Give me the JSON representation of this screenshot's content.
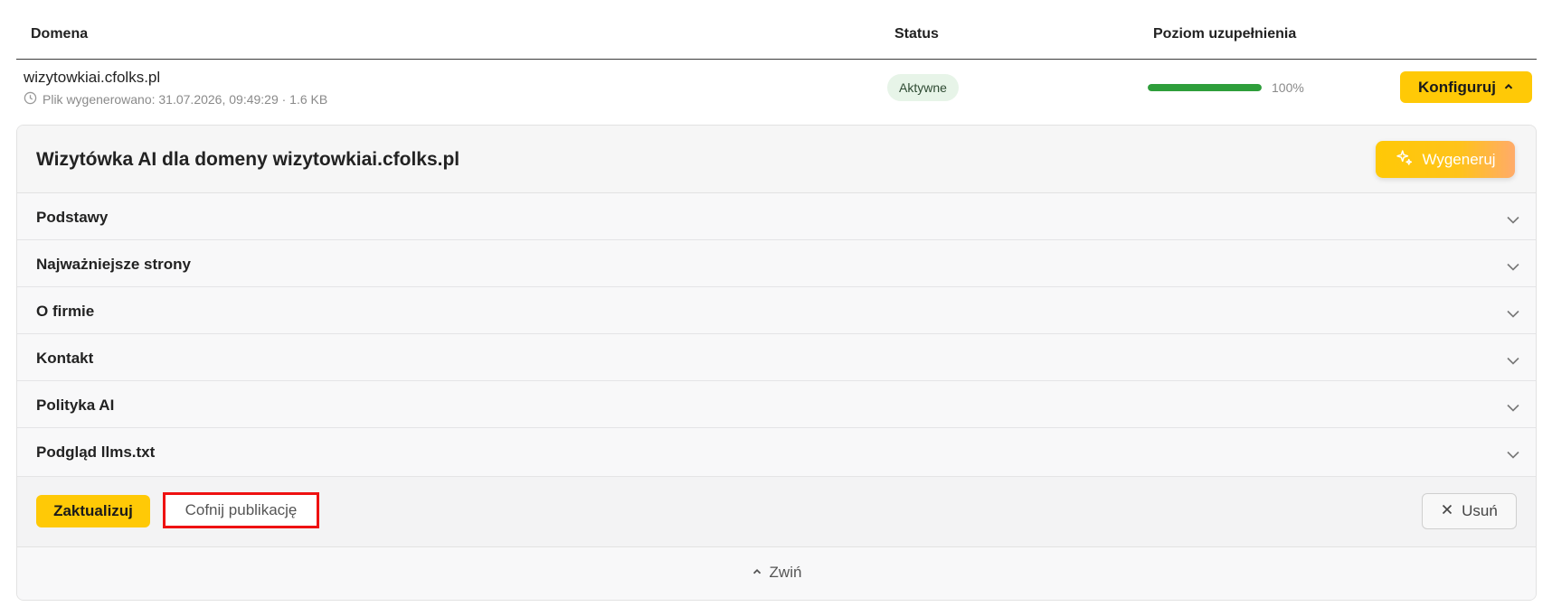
{
  "table": {
    "headers": {
      "domain": "Domena",
      "status": "Status",
      "level": "Poziom uzupełnienia"
    },
    "row": {
      "domain": "wizytowkiai.cfolks.pl",
      "meta": "Plik wygenerowano: 31.07.2026, 09:49:29 · 1.6 KB",
      "meta_icon": "clock-icon",
      "status": "Aktywne",
      "progress_value": 100,
      "progress_label": "100%",
      "configure_label": "Konfiguruj"
    }
  },
  "panel": {
    "title": "Wizytówka AI dla domeny wizytowkiai.cfolks.pl",
    "generate_label": "Wygeneruj",
    "sections": [
      "Podstawy",
      "Najważniejsze strony",
      "O firmie",
      "Kontakt",
      "Polityka AI",
      "Podgląd llms.txt"
    ],
    "actions": {
      "update": "Zaktualizuj",
      "unpublish": "Cofnij publikację",
      "delete": "Usuń"
    },
    "collapse": "Zwiń"
  },
  "colors": {
    "accent": "#ffc906",
    "progress": "#2e9e3b",
    "status_bg": "#e7f4e8",
    "highlight": "#ee1111"
  }
}
